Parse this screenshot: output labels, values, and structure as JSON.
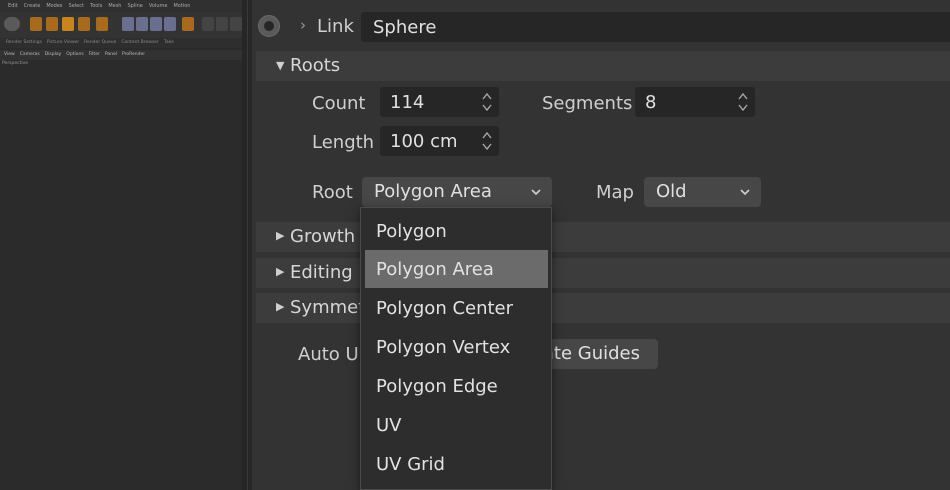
{
  "left_panel": {
    "menu": [
      "Edit",
      "Create",
      "Modes",
      "Select",
      "Tools",
      "Mesh",
      "Spline",
      "Volume",
      "Motion"
    ],
    "tabs": [
      "Render Settings",
      "Picture Viewer",
      "Render Queue",
      "Content Browser",
      "Take"
    ],
    "view_menu": [
      "View",
      "Cameras",
      "Display",
      "Options",
      "Filter",
      "Panel",
      "ProRender"
    ],
    "viewport_label": "Perspective"
  },
  "link": {
    "label": "Link",
    "value": "Sphere"
  },
  "roots": {
    "header": "Roots",
    "count_label": "Count",
    "count_value": "114",
    "segments_label": "Segments",
    "segments_value": "8",
    "length_label": "Length",
    "length_value": "100 cm",
    "root_label": "Root",
    "root_value": "Polygon Area",
    "map_label": "Map",
    "map_value": "Old"
  },
  "groups": {
    "growth": "Growth",
    "editing": "Editing",
    "symmetry": "Symmet"
  },
  "auto_label": "Auto U",
  "guides_button": "ate Guides",
  "dropdown": {
    "options": [
      "Polygon",
      "Polygon Area",
      "Polygon Center",
      "Polygon Vertex",
      "Polygon Edge",
      "UV",
      "UV Grid"
    ],
    "selected": "Polygon Area"
  },
  "colors": {
    "bg": "#333333",
    "field": "#262626",
    "selected": "#6b6b6b"
  }
}
